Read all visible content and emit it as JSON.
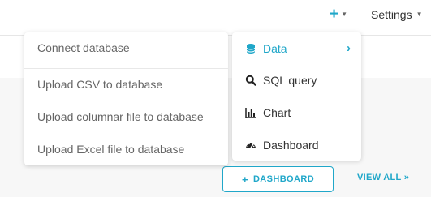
{
  "header": {
    "plus_icon": "+",
    "settings_label": "Settings"
  },
  "data_submenu": {
    "items": [
      {
        "label": "Connect database"
      },
      {
        "label": "Upload CSV to database"
      },
      {
        "label": "Upload columnar file to database"
      },
      {
        "label": "Upload Excel file to database"
      }
    ]
  },
  "new_menu": {
    "items": [
      {
        "label": "Data",
        "icon": "database-icon",
        "has_submenu": true
      },
      {
        "label": "SQL query",
        "icon": "search-icon"
      },
      {
        "label": "Chart",
        "icon": "bar-chart-icon"
      },
      {
        "label": "Dashboard",
        "icon": "dashboard-gauge-icon"
      }
    ]
  },
  "actions": {
    "dashboard_plus": "+",
    "dashboard_label": "DASHBOARD",
    "view_all_label": "VIEW ALL »"
  },
  "colors": {
    "accent": "#20a7c9",
    "menu_text": "#333333",
    "submenu_text": "#666666"
  }
}
